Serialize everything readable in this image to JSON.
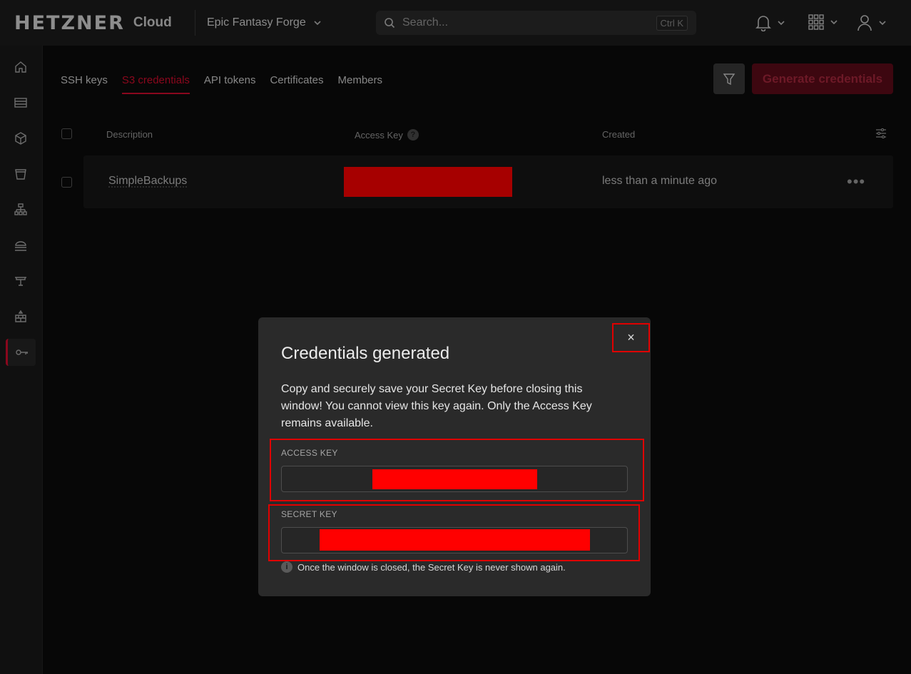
{
  "header": {
    "logo_text": "HETZNER",
    "logo_suffix": "Cloud",
    "project_name": "Epic Fantasy Forge",
    "search_placeholder": "Search...",
    "search_shortcut": "Ctrl K"
  },
  "sidebar": {
    "items": [
      {
        "name": "home",
        "icon": "home-icon"
      },
      {
        "name": "servers",
        "icon": "server-icon"
      },
      {
        "name": "volumes",
        "icon": "box-icon"
      },
      {
        "name": "storage",
        "icon": "bucket-icon"
      },
      {
        "name": "load-balancers",
        "icon": "balancer-icon"
      },
      {
        "name": "networks",
        "icon": "network-icon"
      },
      {
        "name": "ips",
        "icon": "ip-icon"
      },
      {
        "name": "firewalls",
        "icon": "firewall-icon"
      },
      {
        "name": "security",
        "icon": "key-icon",
        "active": true
      }
    ]
  },
  "tabs": [
    {
      "label": "SSH keys",
      "active": false
    },
    {
      "label": "S3 credentials",
      "active": true
    },
    {
      "label": "API tokens",
      "active": false
    },
    {
      "label": "Certificates",
      "active": false
    },
    {
      "label": "Members",
      "active": false
    }
  ],
  "actions": {
    "generate_label": "Generate credentials"
  },
  "table": {
    "columns": [
      "Description",
      "Access Key",
      "Created"
    ],
    "rows": [
      {
        "description": "SimpleBackups",
        "created": "less than a minute ago"
      }
    ]
  },
  "modal": {
    "title": "Credentials generated",
    "close_symbol": "×",
    "message": "Copy and securely save your Secret Key before closing this window! You cannot view this key again. Only the Access Key remains available.",
    "access_key_label": "ACCESS KEY",
    "secret_key_label": "SECRET KEY",
    "note": "Once the window is closed, the Secret Key is never shown again.",
    "info_symbol": "i"
  },
  "colors": {
    "accent": "#d50c2d",
    "redaction": "#ff0000",
    "modal_bg": "#2a2a2a"
  }
}
